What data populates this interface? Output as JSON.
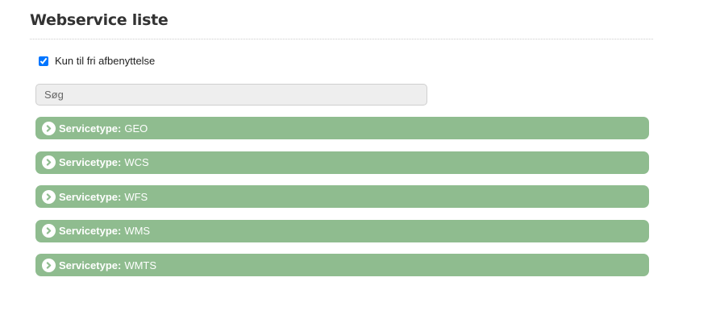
{
  "page": {
    "title": "Webservice liste"
  },
  "filter": {
    "checkbox_label": "Kun til fri afbenyttelse",
    "checked": true
  },
  "search": {
    "placeholder": "Søg",
    "value": ""
  },
  "service_groups": {
    "label": "Servicetype:",
    "icon": "chevron-right-circle-icon",
    "items": [
      {
        "type": "GEO"
      },
      {
        "type": "WCS"
      },
      {
        "type": "WFS"
      },
      {
        "type": "WMS"
      },
      {
        "type": "WMTS"
      }
    ]
  },
  "colors": {
    "accordion_bg": "#8fbc8f",
    "accordion_text": "#ffffff",
    "title_text": "#333333"
  }
}
